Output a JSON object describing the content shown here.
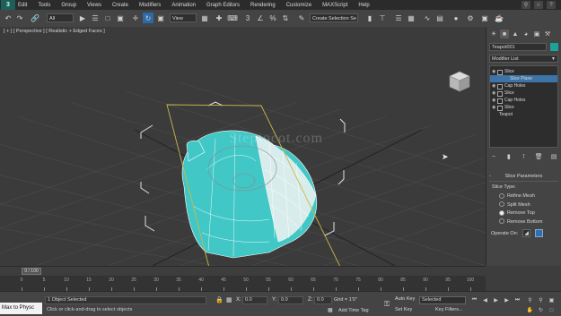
{
  "menu": {
    "logo": "3",
    "items": [
      "Edit",
      "Tools",
      "Group",
      "Views",
      "Create",
      "Modifiers",
      "Animation",
      "Graph Editors",
      "Rendering",
      "Customize",
      "MAXScript",
      "Help"
    ]
  },
  "toolbar": {
    "filter_value": "All",
    "coord_system": "View",
    "named_selection": "Create Selection Se"
  },
  "viewport": {
    "label": "[ + ] [ Perspective ] [ Realistic + Edged Faces ]",
    "watermark": "Steptocot.com"
  },
  "command_panel": {
    "object_name": "Teapot001",
    "object_color": "#1aa39a",
    "modifier_list": "Modifier List",
    "stack": [
      {
        "label": "Slice",
        "indent": false,
        "selected": false,
        "eye": true,
        "box": true
      },
      {
        "label": "Slice Plane",
        "indent": true,
        "selected": true,
        "eye": false,
        "box": false
      },
      {
        "label": "Cap Holes",
        "indent": false,
        "selected": false,
        "eye": true,
        "box": true
      },
      {
        "label": "Slice",
        "indent": false,
        "selected": false,
        "eye": true,
        "box": true
      },
      {
        "label": "Cap Holes",
        "indent": false,
        "selected": false,
        "eye": true,
        "box": true
      },
      {
        "label": "Slice",
        "indent": false,
        "selected": false,
        "eye": true,
        "box": true
      },
      {
        "label": "Teapot",
        "indent": false,
        "selected": false,
        "eye": false,
        "box": false
      }
    ],
    "rollout_title": "Slice Parameters",
    "rollout_toggle": "-",
    "slice_type_label": "Slice Type:",
    "slice_types": [
      {
        "label": "Refine Mesh",
        "on": false
      },
      {
        "label": "Split Mesh",
        "on": false
      },
      {
        "label": "Remove Top",
        "on": true
      },
      {
        "label": "Remove Bottom",
        "on": false
      }
    ],
    "operate_on_label": "Operate On:"
  },
  "timeline": {
    "frame_readout": "0 / 100",
    "ruler_labels": [
      "0",
      "5",
      "10",
      "15",
      "20",
      "25",
      "30",
      "35",
      "40",
      "45",
      "50",
      "55",
      "60",
      "65",
      "70",
      "75",
      "80",
      "85",
      "90",
      "95",
      "100"
    ]
  },
  "statusbar": {
    "maxscript": "Max to Physc",
    "status_text": "1 Object Selected",
    "prompt_text": "Click or click-and-drag to select objects",
    "x_label": "X:",
    "x_value": "0.0",
    "y_label": "Y:",
    "y_value": "0.0",
    "z_label": "Z:",
    "z_value": "0.0",
    "grid_label": "Grid = 1'0\"",
    "add_time_tag": "Add Time Tag",
    "auto_key": "Auto Key",
    "selected_value": "Selected",
    "set_key": "Set Key",
    "key_filters": "Key Filters..."
  },
  "colors": {
    "teapot": "#42c7c7",
    "slice_plane": "#c8b84a",
    "selection_bracket": "#e0e0e0"
  }
}
